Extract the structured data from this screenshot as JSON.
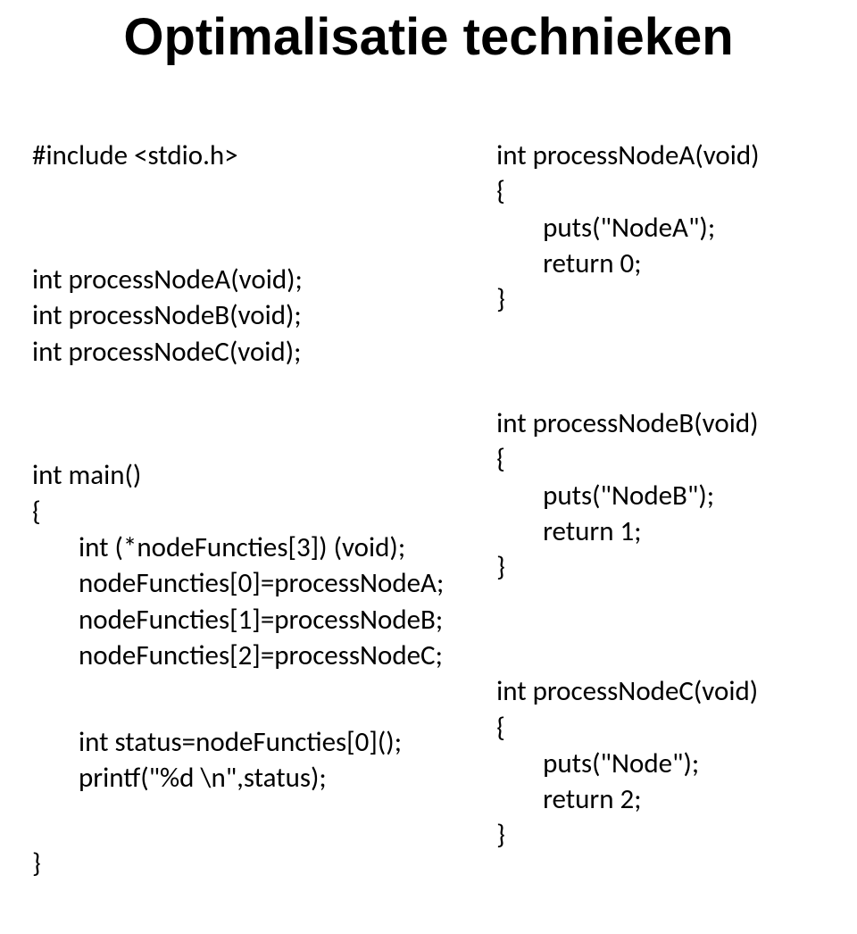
{
  "title": "Optimalisatie technieken",
  "left": {
    "l1": "#include <stdio.h>",
    "l2": "int processNodeA(void);",
    "l3": "int processNodeB(void);",
    "l4": "int processNodeC(void);",
    "l5": "int main()",
    "l6": "{",
    "l7": "int (*nodeFuncties[3]) (void);",
    "l8": "nodeFuncties[0]=processNodeA;",
    "l9": "nodeFuncties[1]=processNodeB;",
    "l10": "nodeFuncties[2]=processNodeC;",
    "l11": "int status=nodeFuncties[0]();",
    "l12": "printf(\"%d \\n\",status);",
    "l13": "}"
  },
  "right": {
    "a1": "int processNodeA(void)",
    "a2": "{",
    "a3": "puts(\"NodeA\");",
    "a4": "return 0;",
    "a5": "}",
    "b1": "int processNodeB(void)",
    "b2": "{",
    "b3": "puts(\"NodeB\");",
    "b4": "return 1;",
    "b5": "}",
    "c1": "int processNodeC(void)",
    "c2": "{",
    "c3": "puts(\"Node\");",
    "c4": "return 2;",
    "c5": "}"
  }
}
